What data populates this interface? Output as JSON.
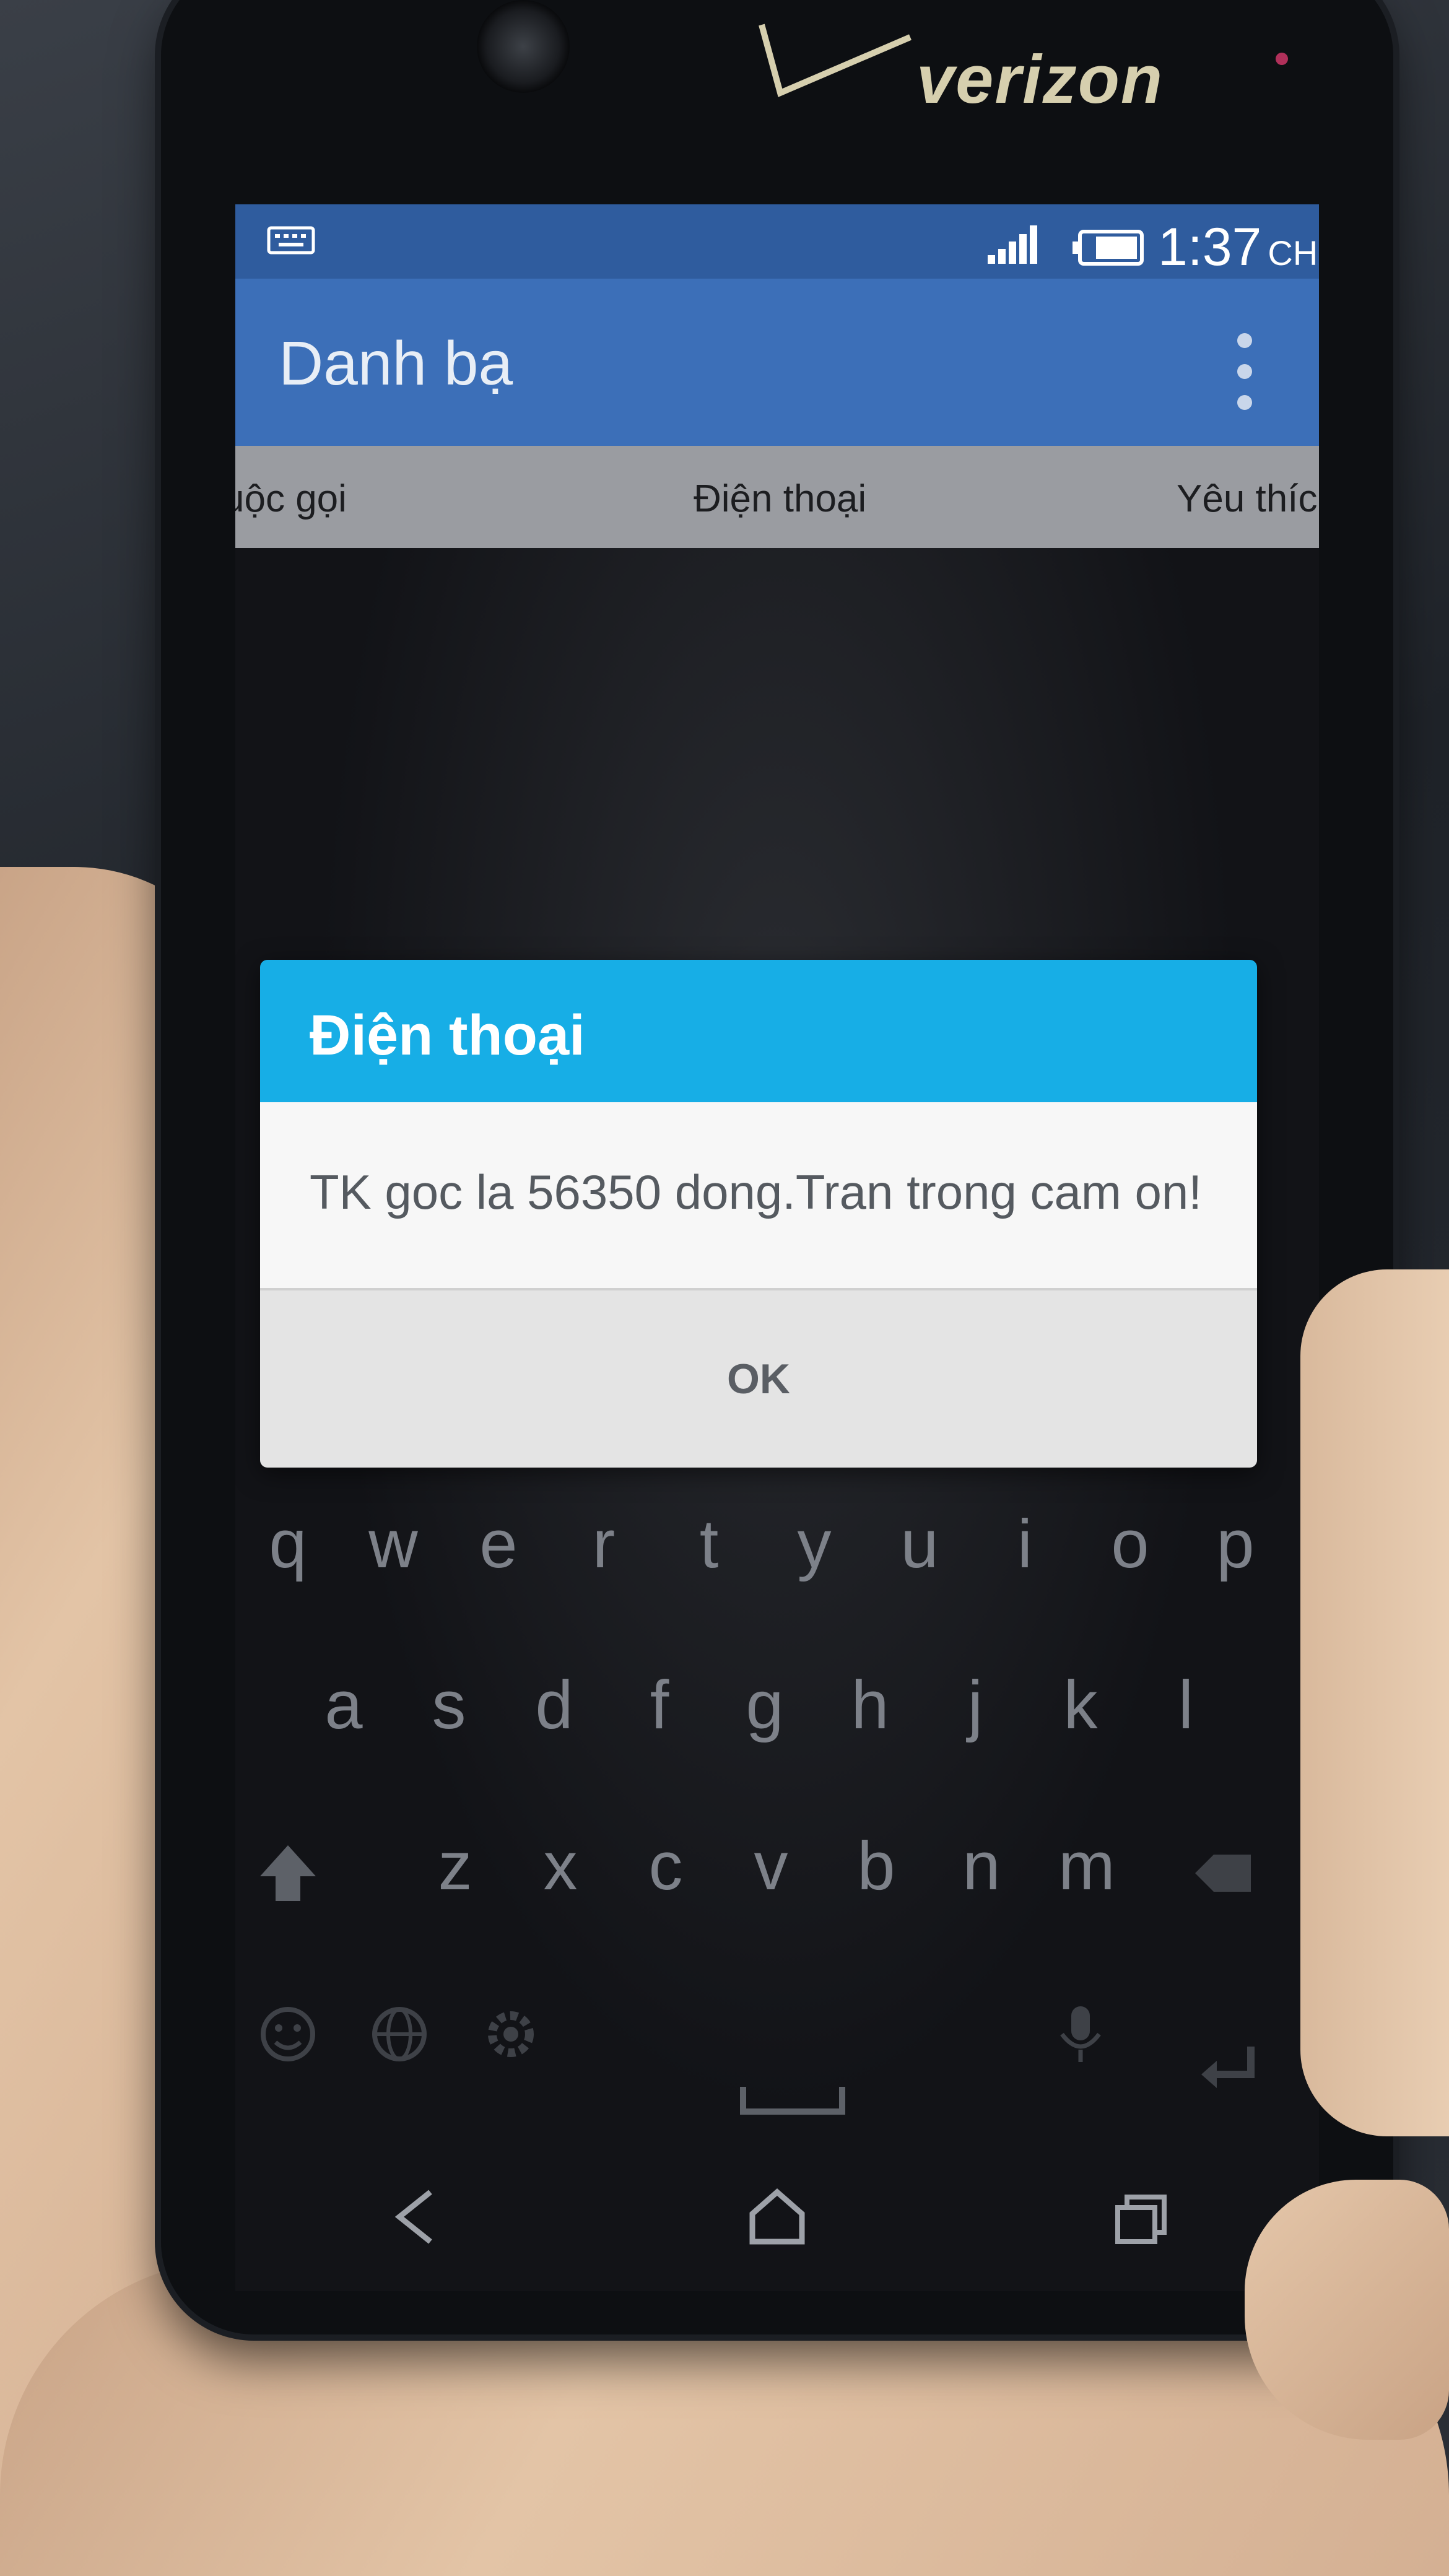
{
  "carrier": {
    "brand": "verizon"
  },
  "status_bar": {
    "time": "1:37",
    "ampm": "CH"
  },
  "app_bar": {
    "title": "Danh bạ"
  },
  "tabs": [
    {
      "label": "uộc gọi"
    },
    {
      "label": "Điện thoại"
    },
    {
      "label": "Yêu thíc"
    }
  ],
  "dialog": {
    "title": "Điện thoại",
    "message": "TK goc la 56350 dong.Tran trong cam on!",
    "ok_label": "OK"
  },
  "keyboard": {
    "row1": [
      "q",
      "w",
      "e",
      "r",
      "t",
      "y",
      "u",
      "i",
      "o",
      "p"
    ],
    "row2": [
      "a",
      "s",
      "d",
      "f",
      "g",
      "h",
      "j",
      "k",
      "l"
    ],
    "row3": [
      "z",
      "x",
      "c",
      "v",
      "b",
      "n",
      "m"
    ]
  },
  "colors": {
    "status_bar": "#2f5c9e",
    "app_bar": "#3c6fb8",
    "dialog_title": "#17aee6"
  }
}
